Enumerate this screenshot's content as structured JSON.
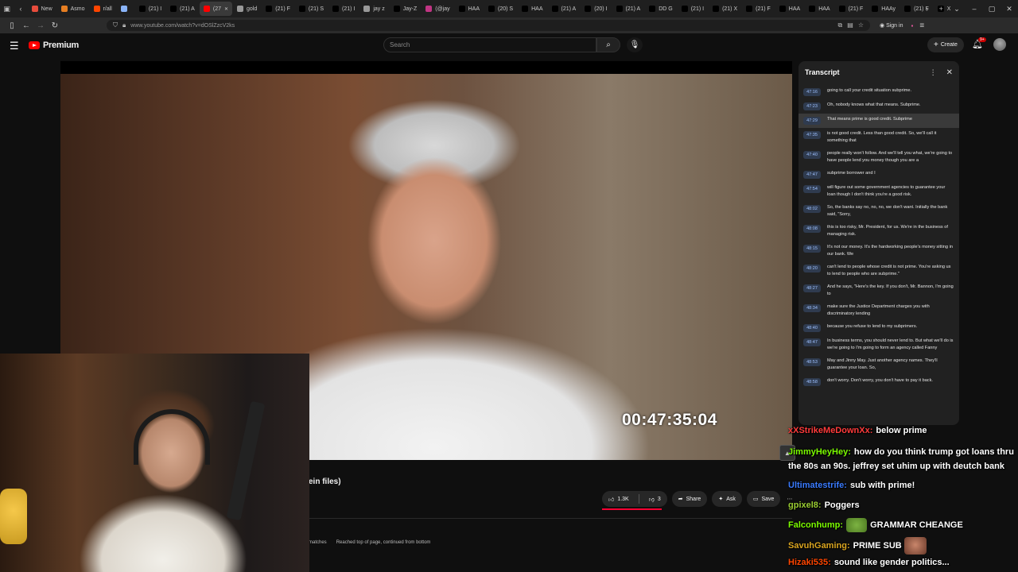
{
  "browser": {
    "tabs": [
      {
        "label": "New",
        "color": "#e74c3c"
      },
      {
        "label": "Asmo",
        "color": "#e67e22"
      },
      {
        "label": "r/all",
        "color": "#ff4500"
      },
      {
        "label": "",
        "color": "#8ab4f8"
      },
      {
        "label": "(21) I",
        "color": "#000000"
      },
      {
        "label": "(21) A",
        "color": "#000000"
      },
      {
        "label": "(27",
        "color": "#ff0000",
        "active": true
      },
      {
        "label": "gold",
        "color": "#999999"
      },
      {
        "label": "(21) F",
        "color": "#000000"
      },
      {
        "label": "(21) S",
        "color": "#000000"
      },
      {
        "label": "(21) I",
        "color": "#000000"
      },
      {
        "label": "jay z",
        "color": "#999999"
      },
      {
        "label": "Jay-Z",
        "color": "#000000"
      },
      {
        "label": "(@jay",
        "color": "#c13584"
      },
      {
        "label": "HAA",
        "color": "#000000"
      },
      {
        "label": "(20) S",
        "color": "#000000"
      },
      {
        "label": "HAA",
        "color": "#000000"
      },
      {
        "label": "(21) A",
        "color": "#000000"
      },
      {
        "label": "(20) I",
        "color": "#000000"
      },
      {
        "label": "(21) A",
        "color": "#000000"
      },
      {
        "label": "DD G",
        "color": "#000000"
      },
      {
        "label": "(21) I",
        "color": "#000000"
      },
      {
        "label": "(21) X",
        "color": "#000000"
      },
      {
        "label": "(21) F",
        "color": "#000000"
      },
      {
        "label": "HAA",
        "color": "#000000"
      },
      {
        "label": "HAA",
        "color": "#000000"
      },
      {
        "label": "(21) F",
        "color": "#000000"
      },
      {
        "label": "HAAy",
        "color": "#000000"
      },
      {
        "label": "(21) F",
        "color": "#000000"
      },
      {
        "label": "X",
        "color": "#000000"
      }
    ],
    "url": "www.youtube.com/watch?v=dOSlZzcV2ks",
    "signin_label": "Sign in"
  },
  "youtube": {
    "logo_text": "Premium",
    "search_placeholder": "Search",
    "create_label": "Create",
    "notif_count": "9+"
  },
  "video": {
    "timecode": "00:47:35:04",
    "title_fragment": "ein files)"
  },
  "transcript": {
    "title": "Transcript",
    "items": [
      {
        "time": "47:16",
        "text": "going to call your credit situation subprime."
      },
      {
        "time": "47:23",
        "text": "Oh, nobody knows what that means. Subprime."
      },
      {
        "time": "47:29",
        "text": "That means prime is good credit. Subprime",
        "active": true
      },
      {
        "time": "47:35",
        "text": "is not good credit. Less than good credit. So, we'll call it something that"
      },
      {
        "time": "47:40",
        "text": "people really won't follow. And we'll tell you what, we're going to have people lend you money though you are a"
      },
      {
        "time": "47:47",
        "text": "subprime borrower and I"
      },
      {
        "time": "47:54",
        "text": "will figure out some government agencies to guarantee your loan though I don't think you're a good risk."
      },
      {
        "time": "48:02",
        "text": "So, the banks say no, no, no, we don't want. Initially the bank said, \"Sorry,"
      },
      {
        "time": "48:08",
        "text": "this is too risky, Mr. President, for us. We're in the business of managing risk."
      },
      {
        "time": "48:15",
        "text": "It's not our money. It's the hardworking people's money sitting in our bank. We"
      },
      {
        "time": "48:20",
        "text": "can't lend to people whose credit is not prime. You're asking us to lend to people who are subprime.\""
      },
      {
        "time": "48:27",
        "text": "And he says, \"Here's the key. If you don't, Mr. Bannon, I'm going to"
      },
      {
        "time": "48:34",
        "text": "make sure the Justice Department charges you with discriminatory lending"
      },
      {
        "time": "48:40",
        "text": "because you refuse to lend to my subprimers."
      },
      {
        "time": "48:47",
        "text": "In business terms, you should never lend to. But what we'll do is we're going to I'm going to form an agency called Fanny"
      },
      {
        "time": "48:53",
        "text": "May and Jinny May. Just another agency names. They'll guarantee your loan. So,"
      },
      {
        "time": "48:58",
        "text": "don't worry. Don't worry, you don't have to pay it back."
      }
    ]
  },
  "actions": {
    "like_count": "1.3K",
    "dislike_count": "3",
    "share_label": "Share",
    "ask_label": "Ask",
    "save_label": "Save"
  },
  "findbar": {
    "matches": "matches",
    "status": "Reached top of page, continued from bottom"
  },
  "chat": [
    {
      "user": "xXStrikeMeDownXx:",
      "color": "#ff3b3b",
      "msg": "below prime"
    },
    {
      "user": "JimmyHeyHey:",
      "color": "#7cfc00",
      "msg": "how do you think trump got loans thru the 80s an 90s. jeffrey set uhim up with deutch bank"
    },
    {
      "user": "Ultimatestrife:",
      "color": "#3a7bff",
      "msg": "sub with prime!"
    },
    {
      "user": "gpixel8:",
      "color": "#9acd32",
      "msg": "Poggers"
    },
    {
      "user": "Falconhump:",
      "color": "#7cfc00",
      "msg": "GRAMMAR CHEANGE"
    },
    {
      "user": "SavuhGaming:",
      "color": "#daa520",
      "msg": "PRIME SUB"
    },
    {
      "user": "Hizaki535:",
      "color": "#ff4500",
      "msg": "sound like gender politics..."
    }
  ]
}
